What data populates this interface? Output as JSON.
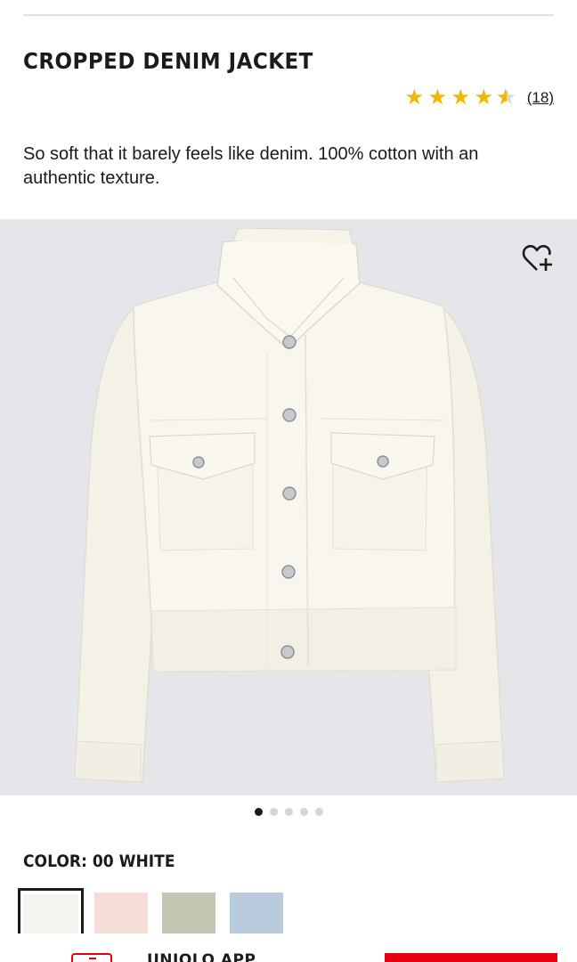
{
  "product": {
    "title": "CROPPED DENIM JACKET",
    "rating_value": 4.5,
    "review_count": "(18)",
    "description": "So soft that it barely feels like denim. 100% cotton with an authentic texture."
  },
  "gallery": {
    "image_alt": "white cropped denim jacket",
    "slide_count": 5,
    "active_slide": 1
  },
  "color": {
    "label": "COLOR: 00 WHITE",
    "swatches": [
      {
        "name": "white",
        "hex": "#f6f4ee",
        "selected": true
      },
      {
        "name": "pink",
        "hex": "#f3ddd5",
        "selected": false
      },
      {
        "name": "olive",
        "hex": "#c3c6b2",
        "selected": false
      },
      {
        "name": "light-blue",
        "hex": "#b9cbdc",
        "selected": false
      }
    ]
  },
  "bottom_bar": {
    "app_label": "UNIQLO APP"
  },
  "colors": {
    "accent_red": "#e60012",
    "star_gold": "#f2b705",
    "image_bg": "#e5e6e9"
  },
  "icons": {
    "wishlist": "heart-plus-icon",
    "star": "star-icon",
    "app": "app-icon"
  }
}
